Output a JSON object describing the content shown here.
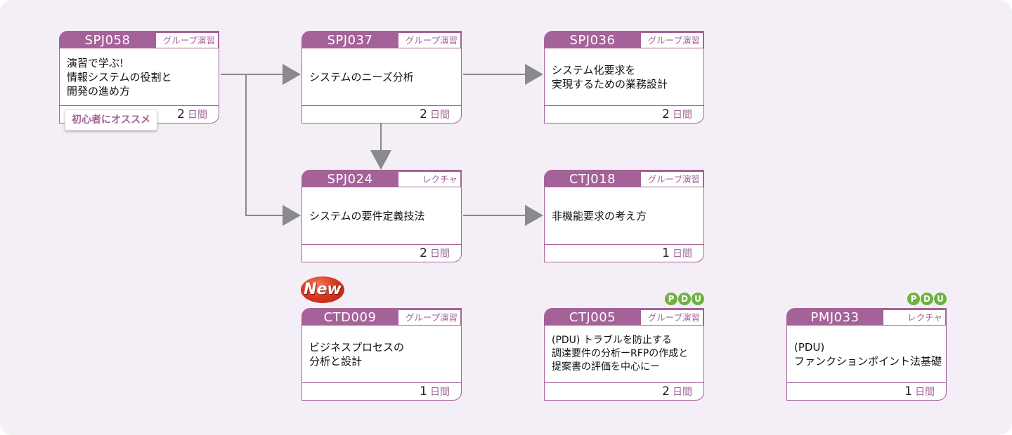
{
  "colors": {
    "background": "#f4eff6",
    "accent": "#a56299",
    "arrow": "#8a8a8a",
    "pdu_green": "#6cb33e",
    "new_red": "#d93a22"
  },
  "duration_unit": "日間",
  "courses": [
    {
      "code": "SPJ058",
      "type": "グループ演習",
      "title": "演習で学ぶ!\n情報システムの役割と\n開発の進め方",
      "days": "2",
      "badge": "初心者にオススメ"
    },
    {
      "code": "SPJ037",
      "type": "グループ演習",
      "title": "システムのニーズ分析",
      "days": "2"
    },
    {
      "code": "SPJ036",
      "type": "グループ演習",
      "title": "システム化要求を\n実現するための業務設計",
      "days": "2"
    },
    {
      "code": "SPJ024",
      "type": "レクチャ",
      "title": "システムの要件定義技法",
      "days": "2"
    },
    {
      "code": "CTJ018",
      "type": "グループ演習",
      "title": "非機能要求の考え方",
      "days": "1"
    },
    {
      "code": "CTD009",
      "type": "グループ演習",
      "title": "ビジネスプロセスの\n分析と設計",
      "days": "1",
      "new_label": "New"
    },
    {
      "code": "CTJ005",
      "type": "グループ演習",
      "title": "(PDU) トラブルを防止する\n調達要件の分析ーRFPの作成と\n提案書の評価を中心にー",
      "days": "2",
      "pdu": [
        "P",
        "D",
        "U"
      ]
    },
    {
      "code": "PMJ033",
      "type": "レクチャ",
      "title": "(PDU)\nファンクションポイント法基礎",
      "days": "1",
      "pdu": [
        "P",
        "D",
        "U"
      ]
    }
  ],
  "flows": [
    {
      "from": "SPJ058",
      "to": "SPJ037"
    },
    {
      "from": "SPJ058",
      "to": "SPJ024"
    },
    {
      "from": "SPJ037",
      "to": "SPJ036"
    },
    {
      "from": "SPJ037",
      "to": "SPJ024"
    },
    {
      "from": "SPJ024",
      "to": "CTJ018"
    }
  ]
}
